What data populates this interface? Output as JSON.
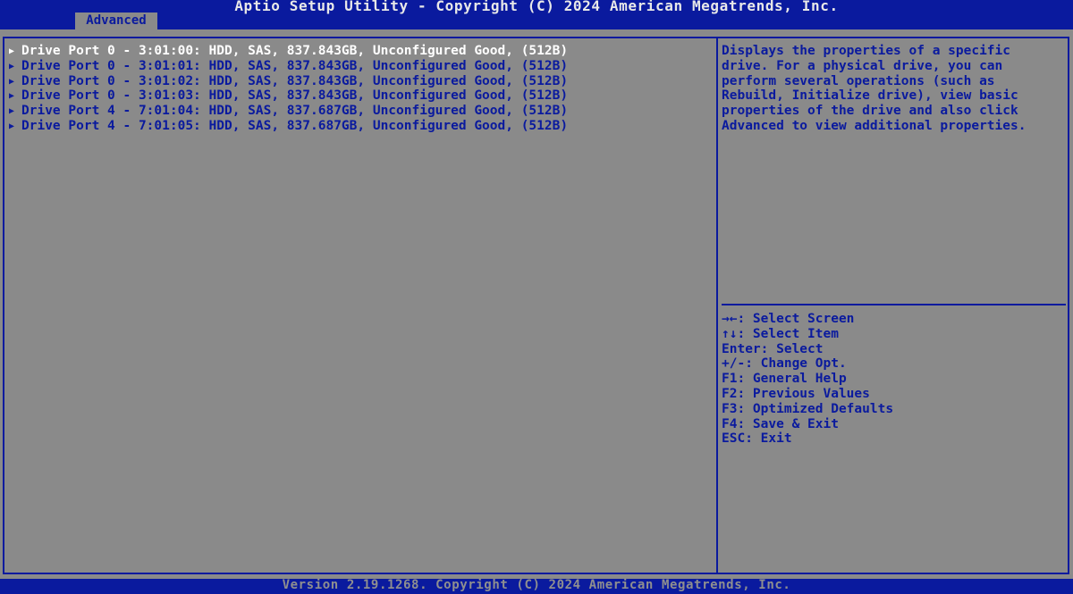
{
  "header": {
    "title": "Aptio Setup Utility - Copyright (C) 2024 American Megatrends, Inc.",
    "tab": "Advanced"
  },
  "drives": [
    {
      "label": "Drive Port 0 - 3:01:00: HDD, SAS, 837.843GB, Unconfigured Good, (512B)",
      "selected": true
    },
    {
      "label": "Drive Port 0 - 3:01:01: HDD, SAS, 837.843GB, Unconfigured Good, (512B)",
      "selected": false
    },
    {
      "label": "Drive Port 0 - 3:01:02: HDD, SAS, 837.843GB, Unconfigured Good, (512B)",
      "selected": false
    },
    {
      "label": "Drive Port 0 - 3:01:03: HDD, SAS, 837.843GB, Unconfigured Good, (512B)",
      "selected": false
    },
    {
      "label": "Drive Port 4 - 7:01:04: HDD, SAS, 837.687GB, Unconfigured Good, (512B)",
      "selected": false
    },
    {
      "label": "Drive Port 4 - 7:01:05: HDD, SAS, 837.687GB, Unconfigured Good, (512B)",
      "selected": false
    }
  ],
  "help": {
    "lines": [
      "Displays the properties of a specific",
      "drive. For a physical drive, you can",
      "perform several operations (such as",
      "Rebuild, Initialize drive), view basic",
      "properties of the drive and also click",
      "Advanced to view additional properties."
    ]
  },
  "keys": [
    "→←: Select Screen",
    "↑↓: Select Item",
    "Enter: Select",
    "+/-: Change Opt.",
    "F1: General Help",
    "F2: Previous Values",
    "F3: Optimized Defaults",
    "F4: Save & Exit",
    "ESC: Exit"
  ],
  "footer": {
    "version": "Version 2.19.1268. Copyright (C) 2024 American Megatrends, Inc."
  },
  "icons": {
    "submenu_arrow": "▶"
  },
  "colors": {
    "frame_blue": "#0a1a9e",
    "panel_gray": "#8a8a8a",
    "selected_text": "#ffffff"
  }
}
